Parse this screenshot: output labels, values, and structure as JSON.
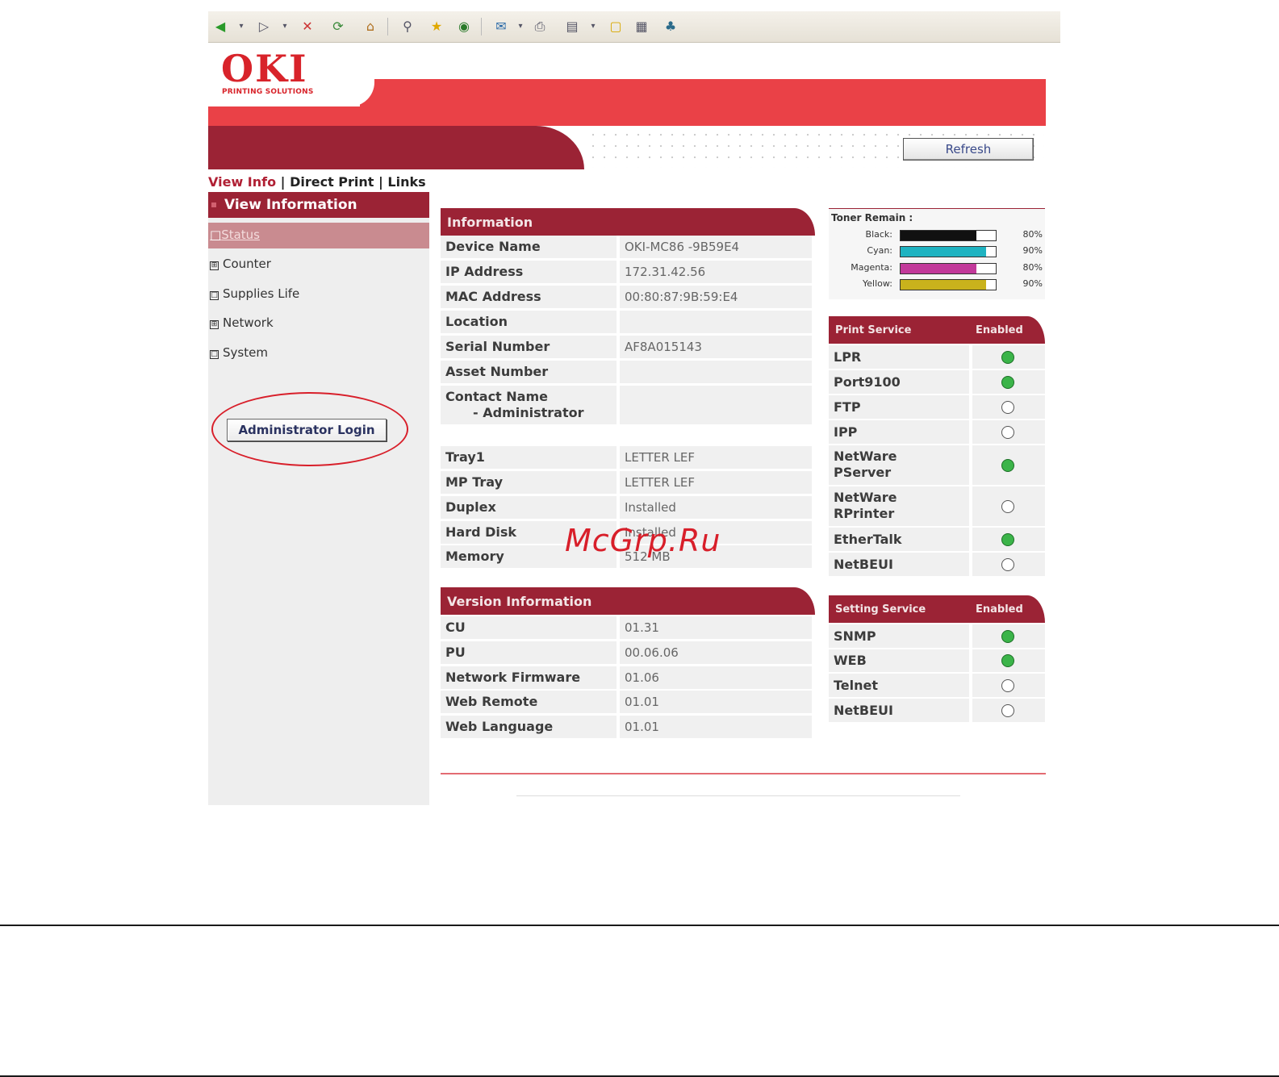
{
  "brand": {
    "logo": "OKI",
    "tagline": "PRINTING SOLUTIONS",
    "accent": "#ea4147",
    "dark_accent": "#9b2335"
  },
  "toolbar": {
    "icons": [
      "back-icon",
      "forward-icon",
      "stop-icon",
      "refresh-icon",
      "home-icon",
      "search-icon",
      "favorites-icon",
      "history-icon",
      "mail-icon",
      "print-icon",
      "edit-icon",
      "discuss-icon",
      "messenger-icon",
      "research-icon"
    ]
  },
  "header": {
    "refresh_label": "Refresh"
  },
  "nav": {
    "view_info": "View Info",
    "sep1": " | ",
    "direct_print": "Direct Print",
    "sep2": " | ",
    "links": "Links"
  },
  "sidebar": {
    "title": "View Information",
    "items": [
      {
        "label": "Status",
        "marker": "□"
      },
      {
        "label": "Counter",
        "marker": "⊞"
      },
      {
        "label": "Supplies Life",
        "marker": "□"
      },
      {
        "label": "Network",
        "marker": "⊞"
      },
      {
        "label": "System",
        "marker": "□"
      }
    ],
    "admin_login": "Administrator Login"
  },
  "information": {
    "title": "Information",
    "rows": [
      {
        "label": "Device Name",
        "value": "OKI-MC86  -9B59E4"
      },
      {
        "label": "IP Address",
        "value": "172.31.42.56"
      },
      {
        "label": "MAC Address",
        "value": "00:80:87:9B:59:E4"
      },
      {
        "label": "Location",
        "value": ""
      },
      {
        "label": "Serial Number",
        "value": "AF8A015143"
      },
      {
        "label": "Asset Number",
        "value": ""
      },
      {
        "label": "Contact Name",
        "label2": "- Administrator",
        "value": ""
      }
    ],
    "rows2": [
      {
        "label": "Tray1",
        "value": "LETTER LEF"
      },
      {
        "label": "MP Tray",
        "value": "LETTER LEF"
      },
      {
        "label": "Duplex",
        "value": "Installed"
      },
      {
        "label": "Hard Disk",
        "value": "Installed"
      },
      {
        "label": "Memory",
        "value": "512 MB"
      }
    ]
  },
  "version": {
    "title": "Version Information",
    "rows": [
      {
        "label": "CU",
        "value": "01.31"
      },
      {
        "label": "PU",
        "value": "00.06.06"
      },
      {
        "label": "Network Firmware",
        "value": "01.06"
      },
      {
        "label": "Web Remote",
        "value": "01.01"
      },
      {
        "label": "Web Language",
        "value": "01.01"
      }
    ]
  },
  "toner": {
    "title": "Toner Remain :",
    "items": [
      {
        "label": "Black:",
        "percent": 80,
        "pct_text": "80%",
        "color": "#111111"
      },
      {
        "label": "Cyan:",
        "percent": 90,
        "pct_text": "90%",
        "color": "#1fb3c1"
      },
      {
        "label": "Magenta:",
        "percent": 80,
        "pct_text": "80%",
        "color": "#c2399a"
      },
      {
        "label": "Yellow:",
        "percent": 90,
        "pct_text": "90%",
        "color": "#c9b21c"
      }
    ]
  },
  "print_service": {
    "title": "Print Service",
    "col": "Enabled",
    "items": [
      {
        "label": "LPR",
        "enabled": true
      },
      {
        "label": "Port9100",
        "enabled": true
      },
      {
        "label": "FTP",
        "enabled": false
      },
      {
        "label": "IPP",
        "enabled": false
      },
      {
        "label": "NetWare",
        "label2": "PServer",
        "enabled": true
      },
      {
        "label": "NetWare",
        "label2": "RPrinter",
        "enabled": false
      },
      {
        "label": "EtherTalk",
        "enabled": true
      },
      {
        "label": "NetBEUI",
        "enabled": false
      }
    ]
  },
  "setting_service": {
    "title": "Setting Service",
    "col": "Enabled",
    "items": [
      {
        "label": "SNMP",
        "enabled": true
      },
      {
        "label": "WEB",
        "enabled": true
      },
      {
        "label": "Telnet",
        "enabled": false
      },
      {
        "label": "NetBEUI",
        "enabled": false
      }
    ]
  },
  "watermark": "McGrp.Ru"
}
